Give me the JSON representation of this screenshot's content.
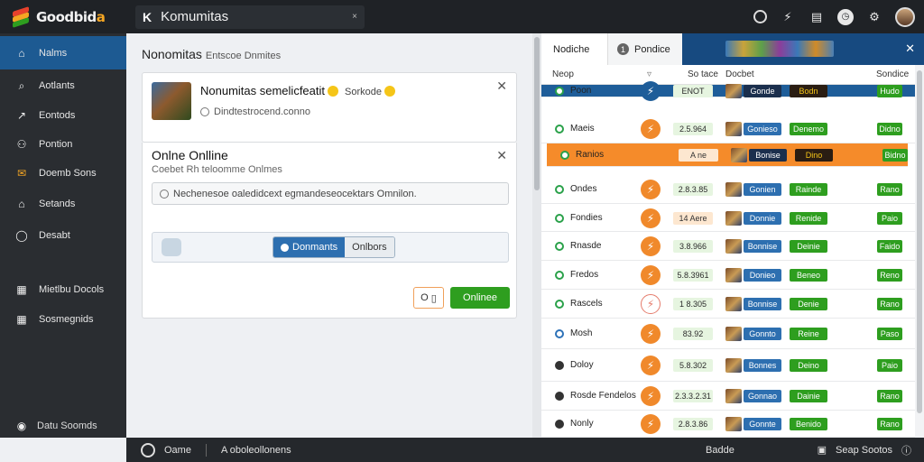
{
  "app": {
    "logo_text_main": "Goodbid",
    "logo_text_accent": "a",
    "window_title": "Komumitas",
    "window_close": "×"
  },
  "sidebar": {
    "items": [
      {
        "label": "Nalms",
        "icon": "home-icon"
      },
      {
        "label": "Aotlants",
        "icon": "search-icon"
      },
      {
        "label": "Eontods",
        "icon": "trend-icon"
      },
      {
        "label": "Pontion",
        "icon": "users-icon"
      },
      {
        "label": "Doemb Sons",
        "icon": "mail-icon"
      },
      {
        "label": "Setands",
        "icon": "home-icon"
      },
      {
        "label": "Desabt",
        "icon": "chat-icon"
      },
      {
        "label": "Mietlbu Docols",
        "icon": "grid-icon"
      },
      {
        "label": "Sosmegnids",
        "icon": "grid-icon"
      }
    ],
    "footer": "Datu Soomds"
  },
  "main": {
    "heading": "Nonomitas",
    "heading_sub": "Entscoe Dnmites",
    "card1": {
      "title": "Nonumitas semelicfeatit",
      "tag": "Sorkode",
      "subtitle": "Dindtestrocend.conno"
    },
    "card2": {
      "title": "Onlne Onlline",
      "subtitle": "Coebet Rh teloomme Onlmes",
      "search_text": "Nechenesoe oaledidcext egmandeseocektars Omnilon.",
      "seg_on": "Donmants",
      "seg_off": "Onlbors",
      "small_button": "O",
      "primary_button": "Onlinee"
    }
  },
  "right": {
    "tabs": {
      "first": "Nodiche",
      "second": "Pondice",
      "second_num": "1"
    },
    "headers": {
      "col1": "Neop",
      "col2": "▿",
      "col3": "So tace",
      "col4": "Docbet",
      "col5": "Sondice"
    },
    "rows": [
      {
        "name": "Poon",
        "price": "ENOT",
        "game": "Gonde",
        "status": "Bodn",
        "action": "Hudo",
        "state": "selected"
      },
      {
        "name": "Maeis",
        "price": "2.5.964",
        "game": "Gonieso",
        "status": "Denemo",
        "action": "Didno",
        "state": "normal"
      },
      {
        "name": "Ranios",
        "price": "A ne",
        "game": "Bonise",
        "status": "Dino",
        "action": "Bidno",
        "state": "highlight"
      },
      {
        "name": "Ondes",
        "price": "2.8.3.85",
        "game": "Gonien",
        "status": "Rainde",
        "action": "Rano",
        "state": "normal"
      },
      {
        "name": "Fondies",
        "price": "14 Aere",
        "game": "Donnie",
        "status": "Renide",
        "action": "Paio",
        "state": "normal",
        "price_alt": true
      },
      {
        "name": "Rnasde",
        "price": "3.8.966",
        "game": "Bonnise",
        "status": "Deinie",
        "action": "Faido",
        "state": "normal"
      },
      {
        "name": "Fredos",
        "price": "5.8.3961",
        "game": "Donieo",
        "status": "Beneo",
        "action": "Reno",
        "state": "normal"
      },
      {
        "name": "Rascels",
        "price": "1 8.305",
        "game": "Bonnise",
        "status": "Denie",
        "action": "Rano",
        "state": "normal",
        "outline": true
      },
      {
        "name": "Mosh",
        "price": "83.92",
        "game": "Gonnto",
        "status": "Reine",
        "action": "Paso",
        "state": "normal",
        "icon": "blue"
      },
      {
        "name": "Doloy",
        "price": "5.8.302",
        "game": "Bonnes",
        "status": "Deino",
        "action": "Paio",
        "state": "normal",
        "icon": "dark"
      },
      {
        "name": "Rosde Fendelos",
        "price": "2.3.3.2.31",
        "game": "Gonnao",
        "status": "Dainie",
        "action": "Rano",
        "state": "normal",
        "icon": "dark"
      },
      {
        "name": "Nonly",
        "price": "2.8.3.86",
        "game": "Gonnte",
        "status": "Benido",
        "action": "Rano",
        "state": "normal",
        "icon": "dark"
      }
    ]
  },
  "bottombar": {
    "user": "Oame",
    "path": "A oboleollonens",
    "mid": "Badde",
    "right": "Seap Sootos"
  },
  "colors": {
    "accent_blue": "#1d5a92",
    "accent_orange": "#f58b2a",
    "accent_green": "#2e9e1f",
    "dark_bg": "#1f2226"
  }
}
